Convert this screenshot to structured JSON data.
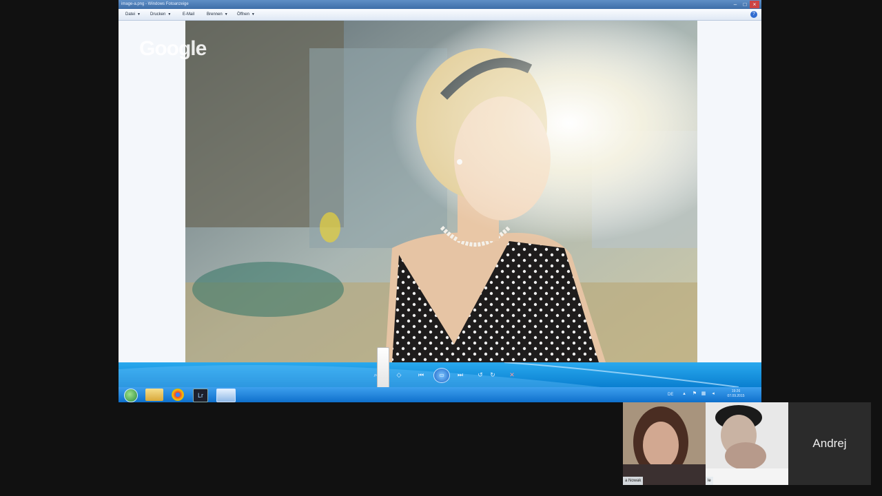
{
  "window": {
    "title": "image-a.png - Windows Fotoanzeige"
  },
  "menu": {
    "items": [
      {
        "label": "Datei"
      },
      {
        "label": "Drucken"
      },
      {
        "label": "E-Mail"
      },
      {
        "label": "Brennen"
      },
      {
        "label": "Öffnen"
      }
    ],
    "help_glyph": "?"
  },
  "overlay": {
    "logo_text": "Google"
  },
  "toolbar": {
    "zoom_glyph": "⌕",
    "fit_glyph": "◇",
    "prev_glyph": "⏮",
    "play_glyph": "▭",
    "next_glyph": "⏭",
    "rotate_left_glyph": "↺",
    "rotate_right_glyph": "↻",
    "delete_glyph": "✕"
  },
  "taskbar": {
    "apps": [
      {
        "icon": "folder-icon"
      },
      {
        "icon": "chrome-icon"
      },
      {
        "icon": "lightroom-icon",
        "text": "Lr"
      },
      {
        "icon": "photo-viewer-icon"
      }
    ],
    "tray": {
      "language": "DE",
      "time": "19:26",
      "date": "07.09.2015"
    }
  },
  "participants": [
    {
      "name": "a Nowak"
    },
    {
      "name": "le"
    },
    {
      "name": "Andrej"
    }
  ],
  "colors": {
    "accent": "#0a7fd0",
    "background": "#111111"
  }
}
